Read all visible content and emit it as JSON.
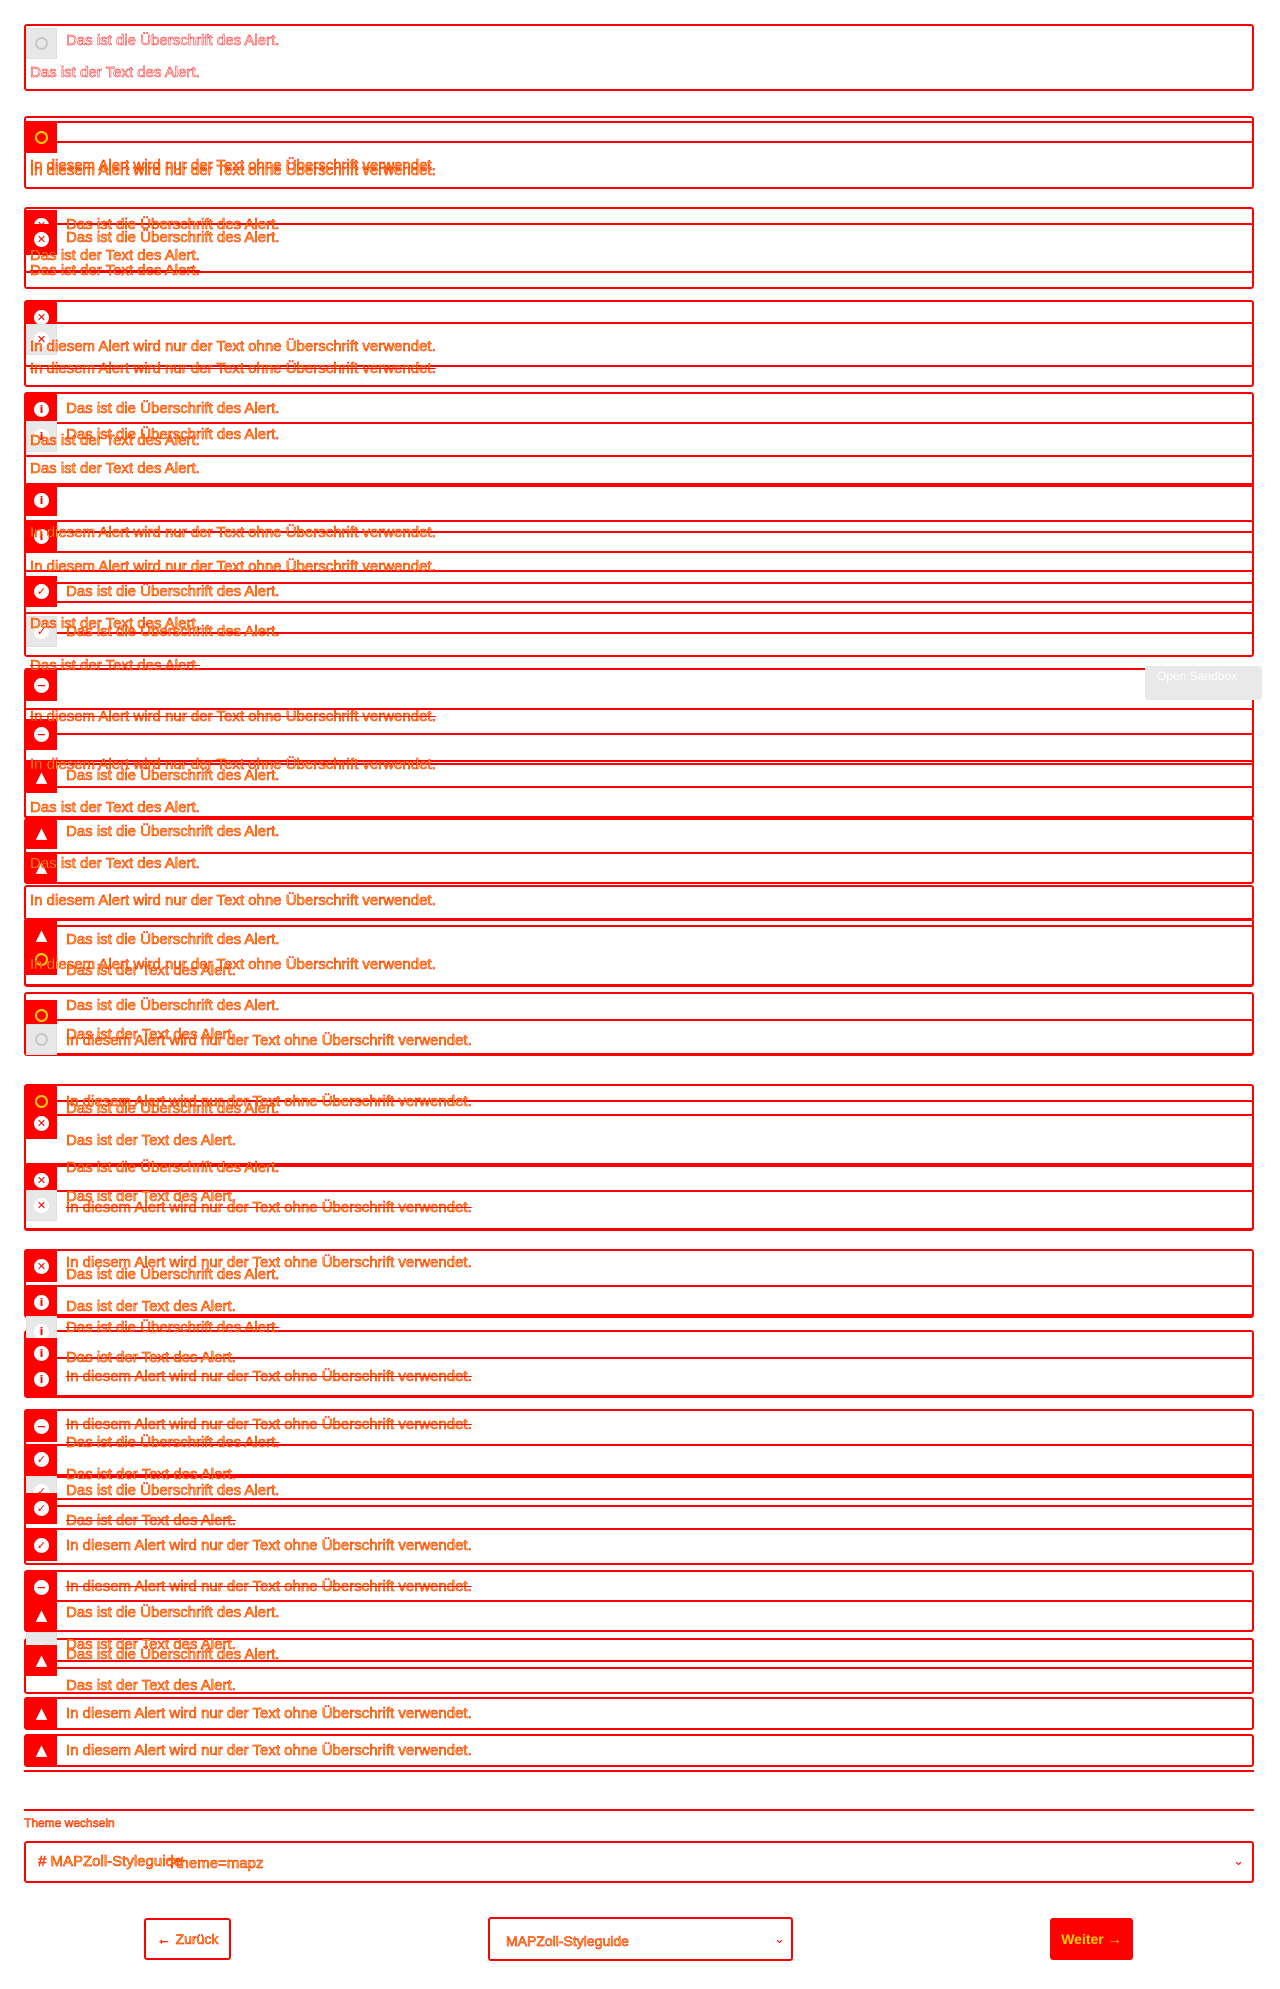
{
  "alerts": {
    "heading": "Das ist die Überschrift des Alert.",
    "text": "Das ist der Text des Alert.",
    "text_only": "In diesem Alert wird nur der Text ohne Überschrift verwendet."
  },
  "sandbox": {
    "label": "Open Sandbox"
  },
  "theme": {
    "label": "Theme wechseln",
    "selected_a": "# MAPZoll-Styleguide",
    "selected_b": "?theme=mapz"
  },
  "nav": {
    "back_label": "Zurück",
    "back_arrow": "←",
    "page_select": "MAPZoll-Styleguide",
    "next_label": "Weiter",
    "next_arrow": "→"
  },
  "icons": {
    "speech": "speech-bubble-icon",
    "error": "close-circle-icon",
    "info": "info-circle-icon",
    "success": "checkmark-circle-icon",
    "neutral": "minus-circle-icon",
    "warning": "warning-triangle-icon",
    "chevron": "chevron-down-icon"
  },
  "colors": {
    "border": "#ff0000",
    "text": "#ffd000",
    "icon_bg": "#ff0000",
    "sandbox_bg": "#e9e9e9"
  }
}
